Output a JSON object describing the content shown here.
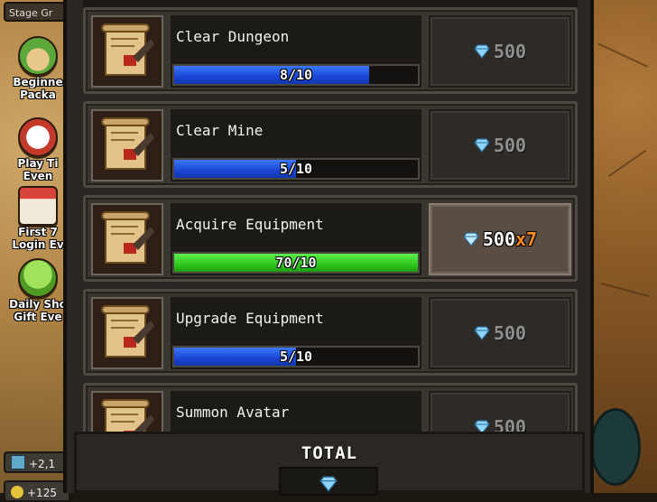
{
  "sidebar": {
    "stage_tab": "Stage Gr",
    "items": [
      {
        "label_1": "Beginne",
        "label_2": "Packa",
        "icon": "sprout-icon"
      },
      {
        "label_1": "Play Ti",
        "label_2": "Even",
        "icon": "clock-icon"
      },
      {
        "label_1": "First 7",
        "label_2": "Login Ev",
        "icon": "calendar-icon"
      },
      {
        "label_1": "Daily Sho",
        "label_2": "Gift Eve",
        "icon": "slime-icon"
      }
    ],
    "currencies": [
      {
        "value": "+2,1",
        "icon": "ticket-icon"
      },
      {
        "value": "+125",
        "icon": "coin-icon"
      }
    ]
  },
  "quests": [
    {
      "name": "Clear Dungeon",
      "progress": "8/10",
      "fill": 0.8,
      "bar": "blue",
      "reward": "500",
      "multiplier": "",
      "claimable": false
    },
    {
      "name": "Clear Mine",
      "progress": "5/10",
      "fill": 0.5,
      "bar": "blue",
      "reward": "500",
      "multiplier": "",
      "claimable": false
    },
    {
      "name": "Acquire Equipment",
      "progress": "70/10",
      "fill": 1.0,
      "bar": "green",
      "reward": "500",
      "multiplier": "x7",
      "claimable": true
    },
    {
      "name": "Upgrade Equipment",
      "progress": "5/10",
      "fill": 0.5,
      "bar": "blue",
      "reward": "500",
      "multiplier": "",
      "claimable": false
    },
    {
      "name": "Summon Avatar",
      "progress": "",
      "fill": 0,
      "bar": "blue",
      "reward": "500",
      "multiplier": "",
      "claimable": false
    }
  ],
  "footer": {
    "total_label": "TOTAL"
  },
  "colors": {
    "progress_blue": "#1a46d4",
    "progress_green": "#2fc61e",
    "multiplier_orange": "#ff8a1f",
    "gem_blue": "#7fd4ff"
  }
}
